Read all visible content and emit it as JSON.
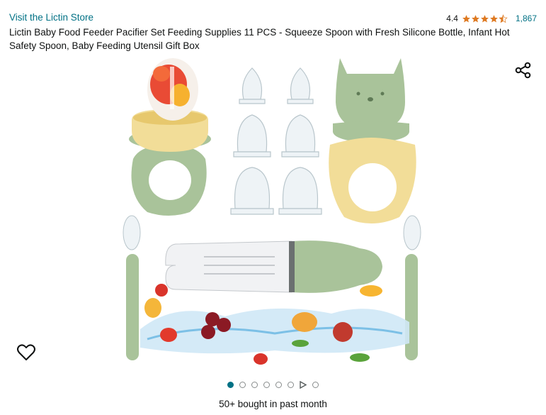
{
  "store": {
    "label": "Visit the Lictin Store"
  },
  "rating": {
    "value": "4.4",
    "stars": 4.4,
    "count": "1,867",
    "star_color": "#de7921"
  },
  "product": {
    "title": "Lictin Baby Food Feeder Pacifier Set Feeding Supplies 11 PCS - Squeeze Spoon with Fresh Silicone Bottle, Infant Hot Safety Spoon, Baby Feeding Utensil Gift Box"
  },
  "gallery": {
    "total": 8,
    "active_index": 0,
    "video_index": 6
  },
  "icons": {
    "share": "share-icon",
    "wishlist": "heart-icon"
  },
  "social_proof": "50+ bought in past month",
  "colors": {
    "link": "#007185",
    "sage": "#a9c39a",
    "butter": "#f2dd98"
  }
}
